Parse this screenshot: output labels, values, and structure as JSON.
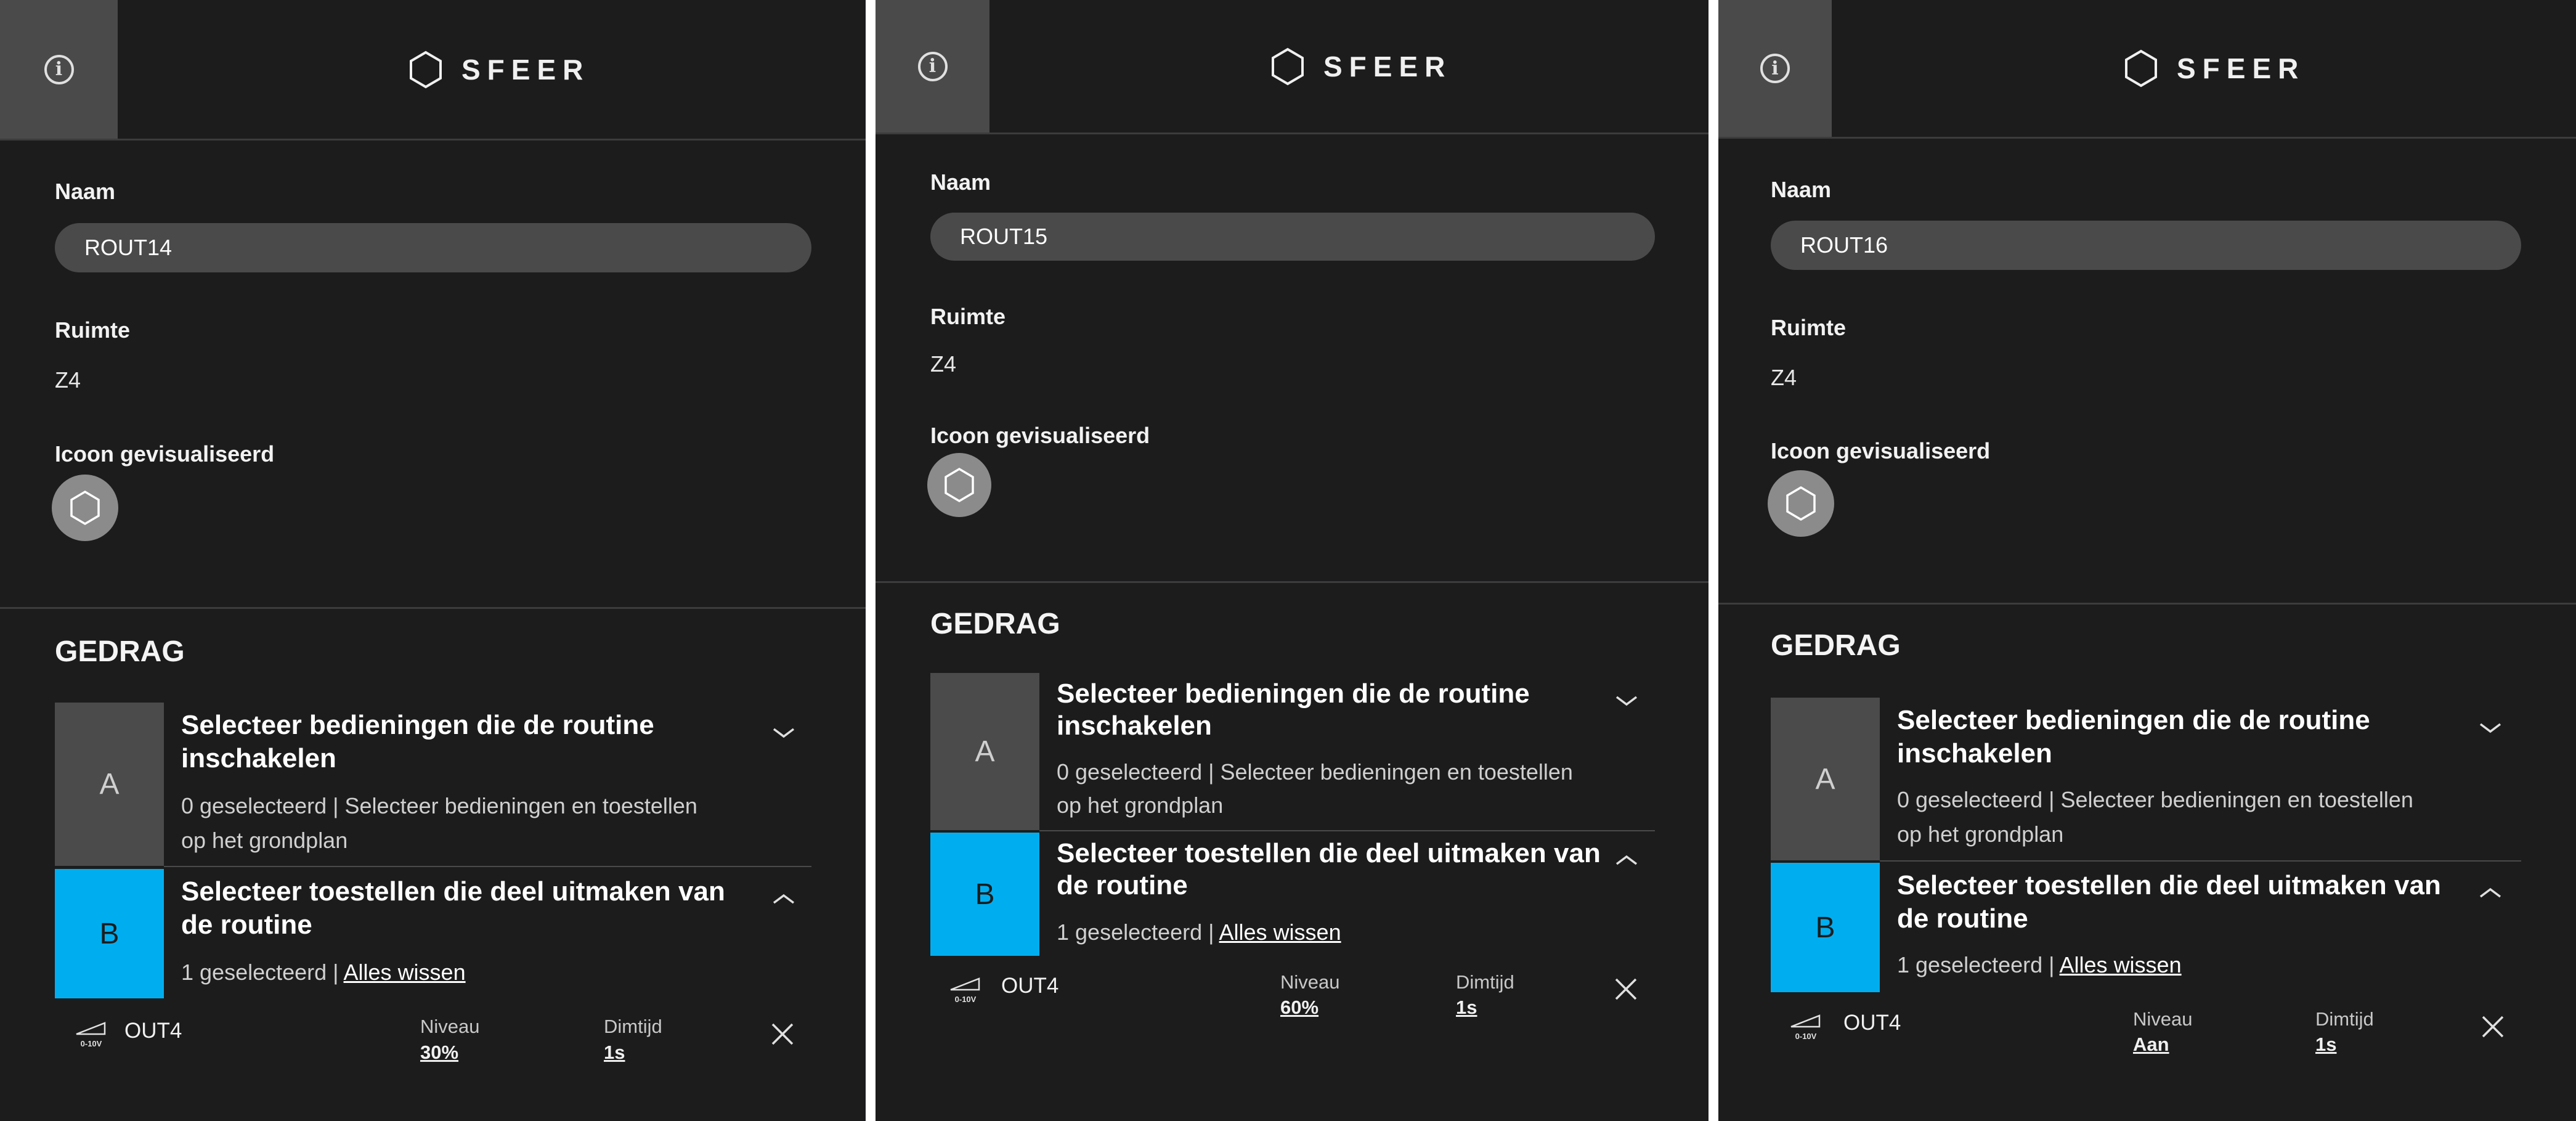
{
  "panels": [
    {
      "brand": "SFEER",
      "name_label": "Naam",
      "name_value": "ROUT14",
      "room_label": "Ruimte",
      "room_value": "Z4",
      "icon_label": "Icoon gevisualiseerd",
      "icon": "hexagon-icon",
      "section_title": "GEDRAG",
      "step_a": {
        "letter": "A",
        "title_line1": "Selecteer bedieningen die de routine",
        "title_line2": "inschakelen",
        "desc_line1": "0 geselecteerd | Selecteer bedieningen en toestellen",
        "desc_line2": "op het grondplan",
        "expanded": false
      },
      "step_b": {
        "letter": "B",
        "title_line1": "Selecteer toestellen die deel uitmaken van",
        "title_line2": "de routine",
        "count_text": "1 geselecteerd | ",
        "clear_link": "Alles wissen",
        "expanded": true
      },
      "device": {
        "icon": "dimmer-0-10v-icon",
        "icon_text": "0-10V",
        "name": "OUT4",
        "level_label": "Niveau",
        "level_value": "30%",
        "dim_label": "Dimtijd",
        "dim_value": "1s"
      }
    },
    {
      "brand": "SFEER",
      "name_label": "Naam",
      "name_value": "ROUT15",
      "room_label": "Ruimte",
      "room_value": "Z4",
      "icon_label": "Icoon gevisualiseerd",
      "icon": "hexagon-icon",
      "section_title": "GEDRAG",
      "step_a": {
        "letter": "A",
        "title_line1": "Selecteer bedieningen die de routine",
        "title_line2": "inschakelen",
        "desc_line1": "0 geselecteerd | Selecteer bedieningen en toestellen",
        "desc_line2": "op het grondplan",
        "expanded": false
      },
      "step_b": {
        "letter": "B",
        "title_line1": "Selecteer toestellen die deel uitmaken van",
        "title_line2": "de routine",
        "count_text": "1 geselecteerd | ",
        "clear_link": "Alles wissen",
        "expanded": true
      },
      "device": {
        "icon": "dimmer-0-10v-icon",
        "icon_text": "0-10V",
        "name": "OUT4",
        "level_label": "Niveau",
        "level_value": "60%",
        "dim_label": "Dimtijd",
        "dim_value": "1s"
      }
    },
    {
      "brand": "SFEER",
      "name_label": "Naam",
      "name_value": "ROUT16",
      "room_label": "Ruimte",
      "room_value": "Z4",
      "icon_label": "Icoon gevisualiseerd",
      "icon": "hexagon-icon",
      "section_title": "GEDRAG",
      "step_a": {
        "letter": "A",
        "title_line1": "Selecteer bedieningen die de routine",
        "title_line2": "inschakelen",
        "desc_line1": "0 geselecteerd | Selecteer bedieningen en toestellen",
        "desc_line2": "op het grondplan",
        "expanded": false
      },
      "step_b": {
        "letter": "B",
        "title_line1": "Selecteer toestellen die deel uitmaken van",
        "title_line2": "de routine",
        "count_text": "1 geselecteerd | ",
        "clear_link": "Alles wissen",
        "expanded": true
      },
      "device": {
        "icon": "dimmer-0-10v-icon",
        "icon_text": "0-10V",
        "name": "OUT4",
        "level_label": "Niveau",
        "level_value": "Aan",
        "dim_label": "Dimtijd",
        "dim_value": "1s"
      }
    }
  ],
  "colors": {
    "panel_bg": "#1c1c1d",
    "header_button_bg": "#4a4a4a",
    "input_bg": "#4a4a4a",
    "step_a_bg": "#4b4b4b",
    "step_b_accent": "#00aeef",
    "icon_circle_bg": "#8b8b8b",
    "divider": "#3c3c3c"
  }
}
